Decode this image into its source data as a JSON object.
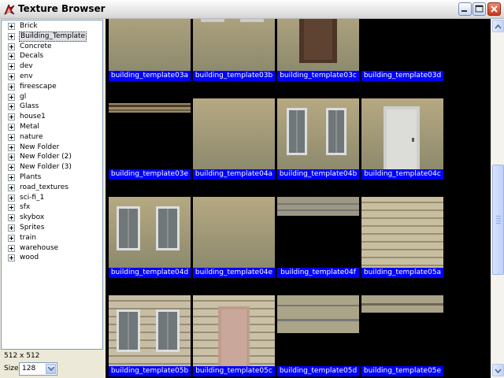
{
  "window": {
    "title": "Texture Browser",
    "icon": "app-logo-icon",
    "buttons": [
      "minimize-icon",
      "maximize-icon",
      "close-icon"
    ]
  },
  "tree": {
    "items": [
      {
        "label": "Brick"
      },
      {
        "label": "Building_Template",
        "selected": true
      },
      {
        "label": "Concrete"
      },
      {
        "label": "Decals"
      },
      {
        "label": "dev"
      },
      {
        "label": "env"
      },
      {
        "label": "fireescape"
      },
      {
        "label": "gl"
      },
      {
        "label": "Glass"
      },
      {
        "label": "house1"
      },
      {
        "label": "Metal"
      },
      {
        "label": "nature"
      },
      {
        "label": "New Folder"
      },
      {
        "label": "New Folder (2)"
      },
      {
        "label": "New Folder (3)"
      },
      {
        "label": "Plants"
      },
      {
        "label": "road_textures"
      },
      {
        "label": "sci-fi_1"
      },
      {
        "label": "sfx"
      },
      {
        "label": "skybox"
      },
      {
        "label": "Sprites"
      },
      {
        "label": "train"
      },
      {
        "label": "warehouse"
      },
      {
        "label": "wood"
      }
    ]
  },
  "status": {
    "dimensions": "512 x 512",
    "size_label": "Size:",
    "size_value": "128"
  },
  "textures": [
    {
      "name": "building_template03a"
    },
    {
      "name": "building_template03b"
    },
    {
      "name": "building_template03c"
    },
    {
      "name": "building_template03d"
    },
    {
      "name": "building_template03e"
    },
    {
      "name": "building_template04a"
    },
    {
      "name": "building_template04b"
    },
    {
      "name": "building_template04c"
    },
    {
      "name": "building_template04d"
    },
    {
      "name": "building_template04e"
    },
    {
      "name": "building_template04f"
    },
    {
      "name": "building_template05a"
    },
    {
      "name": "building_template05b"
    },
    {
      "name": "building_template05c"
    },
    {
      "name": "building_template05d"
    },
    {
      "name": "building_template05e"
    }
  ],
  "colors": {
    "label_bg": "#0000ff",
    "label_text": "#ffffff",
    "viewport_bg": "#000000"
  }
}
